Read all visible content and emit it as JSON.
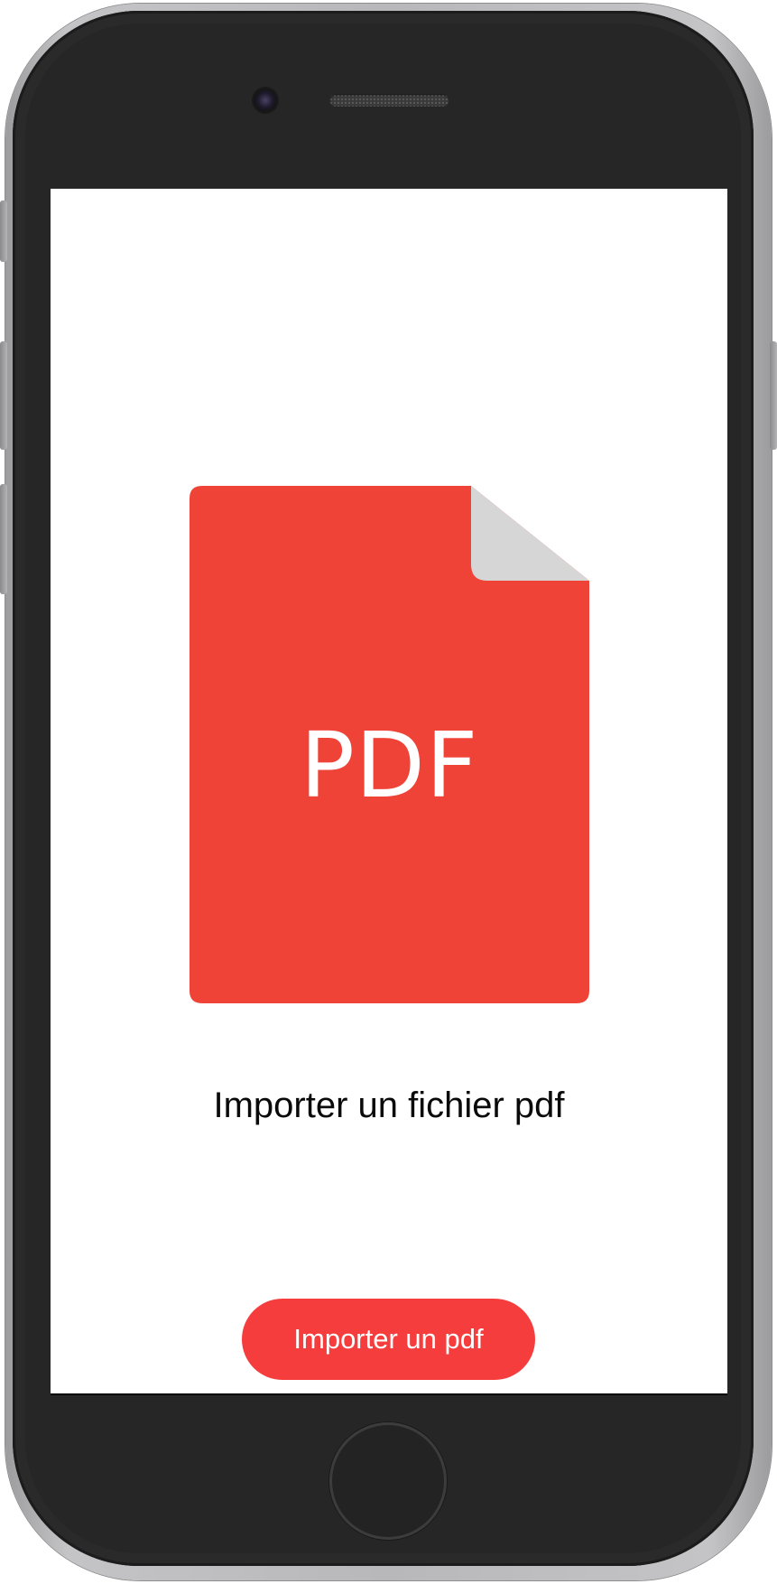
{
  "app": {
    "file_icon": "pdf-file-icon",
    "file_icon_label": "PDF",
    "heading": "Importer un fichier pdf",
    "import_button_label": "Importer un pdf"
  },
  "colors": {
    "file_icon": "#ef4338",
    "file_fold": "#d6d6d6",
    "button": "#f53d3d",
    "screen_background": "#ffffff"
  }
}
